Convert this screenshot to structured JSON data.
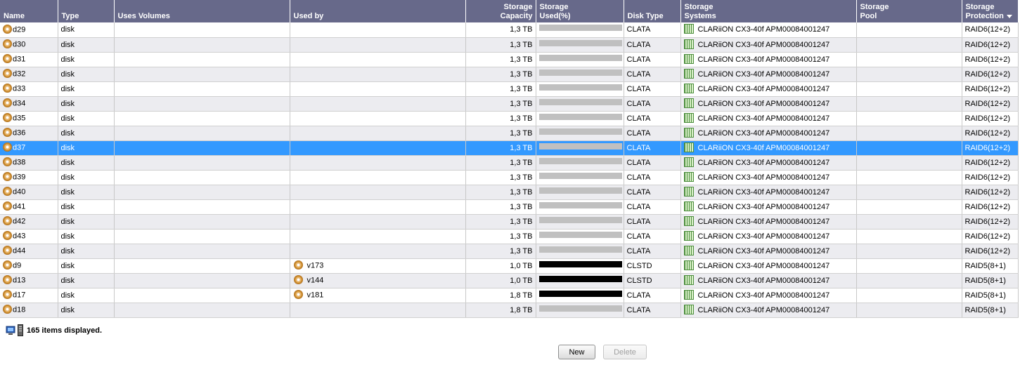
{
  "columns": {
    "name": "Name",
    "type": "Type",
    "uses_volumes": "Uses Volumes",
    "used_by": "Used by",
    "capacity_l1": "Storage",
    "capacity_l2": "Capacity",
    "used_l1": "Storage",
    "used_l2": "Used(%)",
    "disk_type": "Disk Type",
    "systems_l1": "Storage",
    "systems_l2": "Systems",
    "pool_l1": "Storage",
    "pool_l2": "Pool",
    "protection_l1": "Storage",
    "protection_l2": "Protection"
  },
  "colors": {
    "header": "#67698a",
    "selected": "#3399ff",
    "bar_low": "#c0c0c0",
    "bar_full": "#000000"
  },
  "rows": [
    {
      "name": "d29",
      "type": "disk",
      "uses_volumes": "",
      "used_by": "",
      "capacity": "1,3 TB",
      "used_pct": 0,
      "disk_type": "CLATA",
      "storage_system": "CLARiiON CX3-40f APM00084001247",
      "pool": "",
      "protection": "RAID6(12+2)"
    },
    {
      "name": "d30",
      "type": "disk",
      "uses_volumes": "",
      "used_by": "",
      "capacity": "1,3 TB",
      "used_pct": 0,
      "disk_type": "CLATA",
      "storage_system": "CLARiiON CX3-40f APM00084001247",
      "pool": "",
      "protection": "RAID6(12+2)"
    },
    {
      "name": "d31",
      "type": "disk",
      "uses_volumes": "",
      "used_by": "",
      "capacity": "1,3 TB",
      "used_pct": 0,
      "disk_type": "CLATA",
      "storage_system": "CLARiiON CX3-40f APM00084001247",
      "pool": "",
      "protection": "RAID6(12+2)"
    },
    {
      "name": "d32",
      "type": "disk",
      "uses_volumes": "",
      "used_by": "",
      "capacity": "1,3 TB",
      "used_pct": 0,
      "disk_type": "CLATA",
      "storage_system": "CLARiiON CX3-40f APM00084001247",
      "pool": "",
      "protection": "RAID6(12+2)"
    },
    {
      "name": "d33",
      "type": "disk",
      "uses_volumes": "",
      "used_by": "",
      "capacity": "1,3 TB",
      "used_pct": 0,
      "disk_type": "CLATA",
      "storage_system": "CLARiiON CX3-40f APM00084001247",
      "pool": "",
      "protection": "RAID6(12+2)"
    },
    {
      "name": "d34",
      "type": "disk",
      "uses_volumes": "",
      "used_by": "",
      "capacity": "1,3 TB",
      "used_pct": 0,
      "disk_type": "CLATA",
      "storage_system": "CLARiiON CX3-40f APM00084001247",
      "pool": "",
      "protection": "RAID6(12+2)"
    },
    {
      "name": "d35",
      "type": "disk",
      "uses_volumes": "",
      "used_by": "",
      "capacity": "1,3 TB",
      "used_pct": 0,
      "disk_type": "CLATA",
      "storage_system": "CLARiiON CX3-40f APM00084001247",
      "pool": "",
      "protection": "RAID6(12+2)"
    },
    {
      "name": "d36",
      "type": "disk",
      "uses_volumes": "",
      "used_by": "",
      "capacity": "1,3 TB",
      "used_pct": 0,
      "disk_type": "CLATA",
      "storage_system": "CLARiiON CX3-40f APM00084001247",
      "pool": "",
      "protection": "RAID6(12+2)"
    },
    {
      "name": "d37",
      "type": "disk",
      "uses_volumes": "",
      "used_by": "",
      "capacity": "1,3 TB",
      "used_pct": 0,
      "disk_type": "CLATA",
      "storage_system": "CLARiiON CX3-40f APM00084001247",
      "pool": "",
      "protection": "RAID6(12+2)",
      "selected": true
    },
    {
      "name": "d38",
      "type": "disk",
      "uses_volumes": "",
      "used_by": "",
      "capacity": "1,3 TB",
      "used_pct": 0,
      "disk_type": "CLATA",
      "storage_system": "CLARiiON CX3-40f APM00084001247",
      "pool": "",
      "protection": "RAID6(12+2)"
    },
    {
      "name": "d39",
      "type": "disk",
      "uses_volumes": "",
      "used_by": "",
      "capacity": "1,3 TB",
      "used_pct": 0,
      "disk_type": "CLATA",
      "storage_system": "CLARiiON CX3-40f APM00084001247",
      "pool": "",
      "protection": "RAID6(12+2)"
    },
    {
      "name": "d40",
      "type": "disk",
      "uses_volumes": "",
      "used_by": "",
      "capacity": "1,3 TB",
      "used_pct": 0,
      "disk_type": "CLATA",
      "storage_system": "CLARiiON CX3-40f APM00084001247",
      "pool": "",
      "protection": "RAID6(12+2)"
    },
    {
      "name": "d41",
      "type": "disk",
      "uses_volumes": "",
      "used_by": "",
      "capacity": "1,3 TB",
      "used_pct": 0,
      "disk_type": "CLATA",
      "storage_system": "CLARiiON CX3-40f APM00084001247",
      "pool": "",
      "protection": "RAID6(12+2)"
    },
    {
      "name": "d42",
      "type": "disk",
      "uses_volumes": "",
      "used_by": "",
      "capacity": "1,3 TB",
      "used_pct": 0,
      "disk_type": "CLATA",
      "storage_system": "CLARiiON CX3-40f APM00084001247",
      "pool": "",
      "protection": "RAID6(12+2)"
    },
    {
      "name": "d43",
      "type": "disk",
      "uses_volumes": "",
      "used_by": "",
      "capacity": "1,3 TB",
      "used_pct": 0,
      "disk_type": "CLATA",
      "storage_system": "CLARiiON CX3-40f APM00084001247",
      "pool": "",
      "protection": "RAID6(12+2)"
    },
    {
      "name": "d44",
      "type": "disk",
      "uses_volumes": "",
      "used_by": "",
      "capacity": "1,3 TB",
      "used_pct": 0,
      "disk_type": "CLATA",
      "storage_system": "CLARiiON CX3-40f APM00084001247",
      "pool": "",
      "protection": "RAID6(12+2)"
    },
    {
      "name": "d9",
      "type": "disk",
      "uses_volumes": "",
      "used_by": "v173",
      "capacity": "1,0 TB",
      "used_pct": 100,
      "disk_type": "CLSTD",
      "storage_system": "CLARiiON CX3-40f APM00084001247",
      "pool": "",
      "protection": "RAID5(8+1)"
    },
    {
      "name": "d13",
      "type": "disk",
      "uses_volumes": "",
      "used_by": "v144",
      "capacity": "1,0 TB",
      "used_pct": 100,
      "disk_type": "CLSTD",
      "storage_system": "CLARiiON CX3-40f APM00084001247",
      "pool": "",
      "protection": "RAID5(8+1)"
    },
    {
      "name": "d17",
      "type": "disk",
      "uses_volumes": "",
      "used_by": "v181",
      "capacity": "1,8 TB",
      "used_pct": 100,
      "disk_type": "CLATA",
      "storage_system": "CLARiiON CX3-40f APM00084001247",
      "pool": "",
      "protection": "RAID5(8+1)"
    },
    {
      "name": "d18",
      "type": "disk",
      "uses_volumes": "",
      "used_by": "",
      "capacity": "1,8 TB",
      "used_pct": 0,
      "disk_type": "CLATA",
      "storage_system": "CLARiiON CX3-40f APM00084001247",
      "pool": "",
      "protection": "RAID5(8+1)"
    }
  ],
  "status": {
    "text": "165 items displayed."
  },
  "buttons": {
    "new_label": "New",
    "delete_label": "Delete"
  }
}
